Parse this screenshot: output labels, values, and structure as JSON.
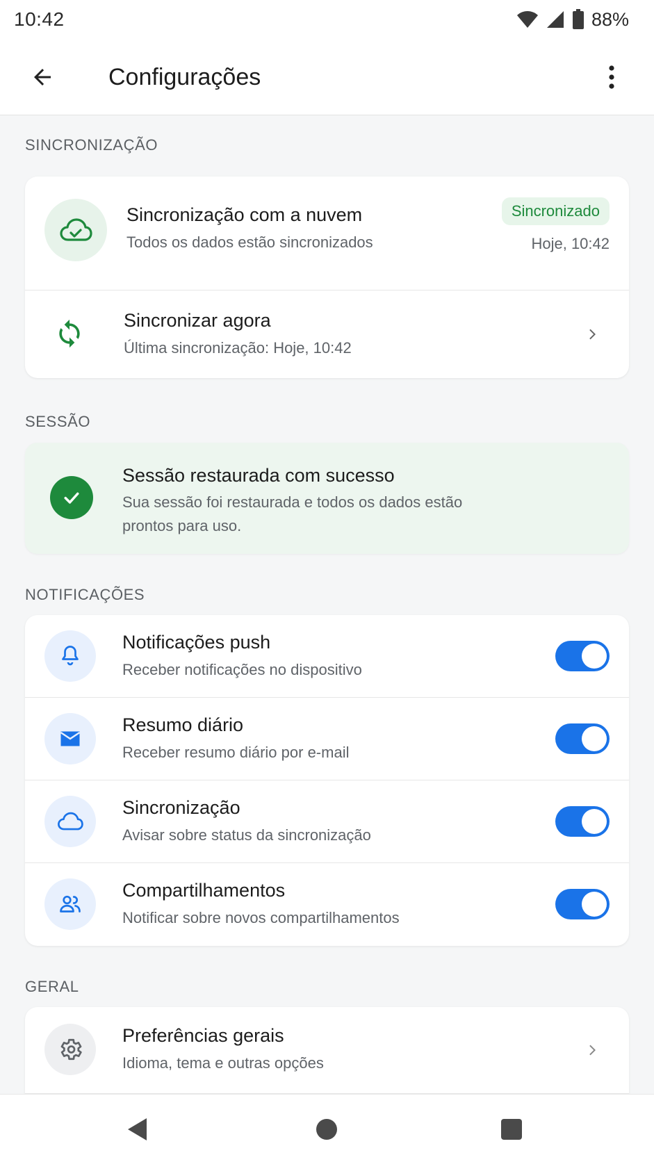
{
  "status_bar": {
    "time": "10:42",
    "battery": "88%",
    "icons": [
      "wifi-icon",
      "signal-icon",
      "battery-icon"
    ]
  },
  "app_bar": {
    "title": "Configurações",
    "back_icon": "arrow-back-icon",
    "more_icon": "more-vert-icon"
  },
  "sync_section": {
    "label": "SINCRONIZAÇÃO",
    "cloud": {
      "title": "Sincronização com a nuvem",
      "subtitle": "Todos os dados estão sincronizados",
      "badge": "Sincronizado",
      "time": "Hoje, 10:42",
      "icon": "cloud-check-icon"
    },
    "sync_now": {
      "title": "Sincronizar agora",
      "subtitle": "Última sincronização: Hoje, 10:42",
      "icon": "sync-icon"
    }
  },
  "session_section": {
    "label": "SESSÃO",
    "title": "Sessão restaurada com sucesso",
    "line1": "Sua sessão foi restaurada e todos os dados estão",
    "line2": "prontos para uso.",
    "icon": "check-circle-icon"
  },
  "notifications_section": {
    "label": "NOTIFICAÇÕES",
    "items": [
      {
        "title": "Notificações push",
        "subtitle": "Receber notificações no dispositivo",
        "icon": "bell-icon",
        "enabled": true
      },
      {
        "title": "Resumo diário",
        "subtitle": "Receber resumo diário por e-mail",
        "icon": "mail-icon",
        "enabled": true
      },
      {
        "title": "Sincronização",
        "subtitle": "Avisar sobre status da sincronização",
        "icon": "cloud-icon",
        "enabled": true
      },
      {
        "title": "Compartilhamentos",
        "subtitle": "Notificar sobre novos compartilhamentos",
        "icon": "people-icon",
        "enabled": true
      }
    ]
  },
  "general_section": {
    "label": "GERAL",
    "items": [
      {
        "title": "Preferências gerais",
        "subtitle": "Idioma, tema e outras opções",
        "icon": "gear-icon"
      }
    ]
  },
  "colors": {
    "accent_blue": "#1a73e8",
    "success_green": "#1e8a3c",
    "badge_bg": "#e7f5ea",
    "success_bg": "#edf6ef"
  }
}
